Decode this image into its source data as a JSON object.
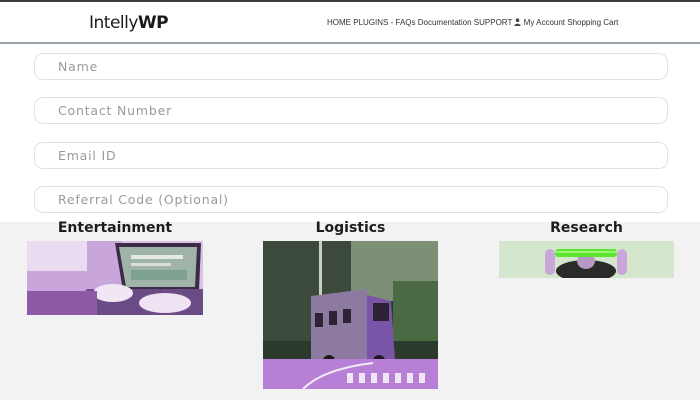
{
  "header": {
    "logo_text": "Intelly",
    "logo_bold": "WP",
    "nav": {
      "home": "HOME",
      "plugins": "PLUGINS",
      "separator": "-",
      "faqs": "FAQs",
      "documentation": "Documentation",
      "support": "SUPPORT",
      "my_account": "My Account",
      "shopping_cart": "Shopping Cart"
    }
  },
  "form": {
    "name_placeholder": "Name",
    "contact_placeholder": "Contact Number",
    "email_placeholder": "Email ID",
    "referral_placeholder": "Referral Code (Optional)"
  },
  "industries": {
    "entertainment": "Entertainment",
    "logistics": "Logistics",
    "research": "Research"
  },
  "colors": {
    "tint": "#b86be0",
    "accent_green": "#5ee62e",
    "section_bg": "#f2f2f2"
  }
}
